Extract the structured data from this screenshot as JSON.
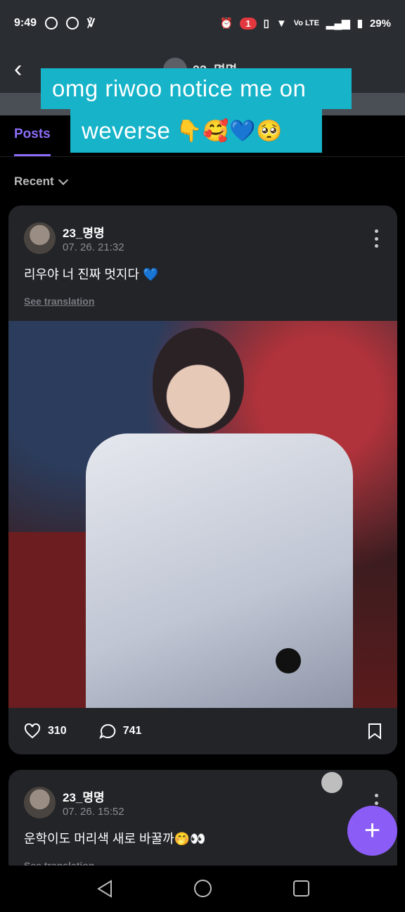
{
  "status_bar": {
    "time": "9:49",
    "badge": "1",
    "network": "Vo LTE",
    "battery": "29%",
    "left_icons": [
      "messenger-icon",
      "vpn-icon",
      "viber-icon"
    ],
    "right_icons": [
      "alarm-icon",
      "vibrate-icon",
      "wifi-icon",
      "signal-icon",
      "battery-icon"
    ]
  },
  "header": {
    "title": "23_명명"
  },
  "overlay": {
    "line1": "omg riwoo notice me on",
    "line2": "weverse",
    "line2_emojis": "👇🥰💙🥺"
  },
  "tabs": [
    {
      "label": "Posts",
      "active": true
    }
  ],
  "sort": {
    "label": "Recent"
  },
  "posts": [
    {
      "author": "23_명명",
      "time": "07. 26. 21:32",
      "text": "리우야 너 진짜 멋지다",
      "text_emoji": "💙",
      "see_translation": "See translation",
      "likes": "310",
      "comments": "741"
    },
    {
      "author": "23_명명",
      "time": "07. 26. 15:52",
      "text": "운학이도 머리색 새로 바꿀까🤭👀",
      "see_translation": "See translation"
    }
  ],
  "fab": {
    "label": "+"
  },
  "colors": {
    "accent": "#8b5cf6",
    "overlay_bg": "#16b3c9",
    "card_bg": "#222428"
  }
}
